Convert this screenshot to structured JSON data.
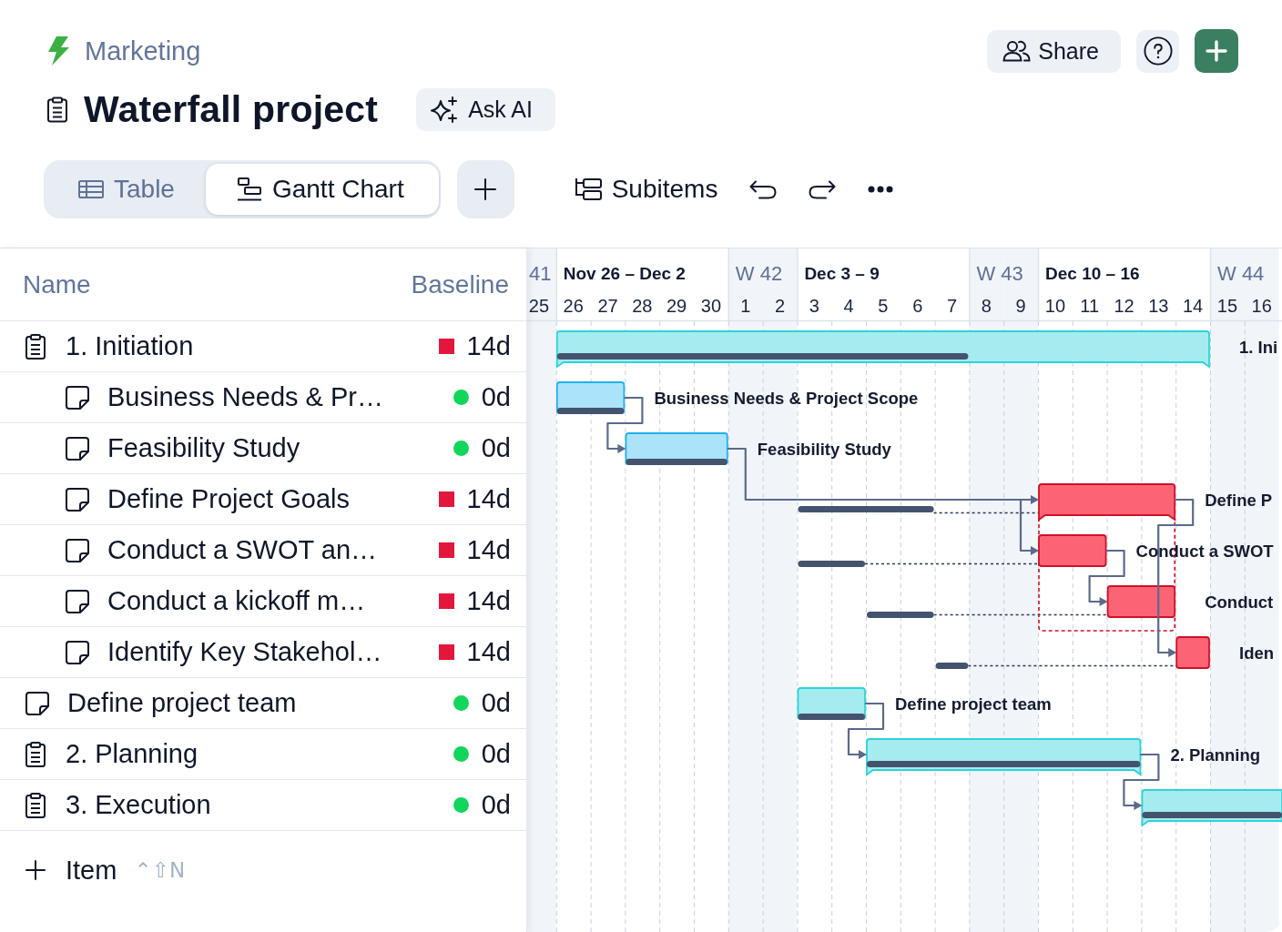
{
  "workspace": {
    "name": "Marketing"
  },
  "header": {
    "share": "Share"
  },
  "board": {
    "title": "Waterfall project",
    "ask_ai": "Ask AI"
  },
  "views": [
    {
      "kind": "table",
      "label": "Table",
      "selected": false
    },
    {
      "kind": "gantt",
      "label": "Gantt Chart",
      "selected": true
    }
  ],
  "toolbar": {
    "subitems": "Subitems"
  },
  "table": {
    "columns": [
      "Name",
      "Baseline"
    ],
    "rows": [
      {
        "kind": "group",
        "name": "1. Initiation",
        "baseline": "14d",
        "marker": {
          "kind": "square",
          "color": "#e3173d"
        },
        "children": [
          {
            "kind": "task",
            "name": "Business Needs & Pr…",
            "baseline": "0d",
            "marker": {
              "kind": "dot",
              "color": "#11d65b"
            }
          },
          {
            "kind": "task",
            "name": "Feasibility Study",
            "baseline": "0d",
            "marker": {
              "kind": "dot",
              "color": "#11d65b"
            }
          },
          {
            "kind": "task",
            "name": "Define Project Goals",
            "baseline": "14d",
            "marker": {
              "kind": "square",
              "color": "#e3173d"
            }
          },
          {
            "kind": "task",
            "name": "Conduct a SWOT an…",
            "baseline": "14d",
            "marker": {
              "kind": "square",
              "color": "#e3173d"
            }
          },
          {
            "kind": "task",
            "name": "Conduct a kickoff m…",
            "baseline": "14d",
            "marker": {
              "kind": "square",
              "color": "#e3173d"
            }
          },
          {
            "kind": "task",
            "name": "Identify Key Stakehol…",
            "baseline": "14d",
            "marker": {
              "kind": "square",
              "color": "#e3173d"
            }
          }
        ]
      },
      {
        "kind": "task",
        "name": "Define project team",
        "baseline": "0d",
        "marker": {
          "kind": "dot",
          "color": "#11d65b"
        }
      },
      {
        "kind": "group",
        "name": "2. Planning",
        "baseline": "0d",
        "marker": {
          "kind": "dot",
          "color": "#11d65b"
        }
      },
      {
        "kind": "group",
        "name": "3. Execution",
        "baseline": "0d",
        "marker": {
          "kind": "dot",
          "color": "#11d65b"
        }
      }
    ],
    "add_item": {
      "label": "Item",
      "shortcut": "⌃⇧N"
    }
  },
  "timeline": {
    "weeks": [
      {
        "label": "41"
      },
      {
        "label": "Nov 26 – Dec 2"
      },
      {
        "label": "W 42"
      },
      {
        "label": "Dec 3 – 9"
      },
      {
        "label": "W 43"
      },
      {
        "label": "Dec 10 – 16"
      },
      {
        "label": "W 44"
      }
    ],
    "days": [
      {
        "label": "25",
        "weekend": true
      },
      {
        "label": "26",
        "weekend": false
      },
      {
        "label": "27",
        "weekend": false
      },
      {
        "label": "28",
        "weekend": false
      },
      {
        "label": "29",
        "weekend": false
      },
      {
        "label": "30",
        "weekend": false
      },
      {
        "label": "1",
        "weekend": true
      },
      {
        "label": "2",
        "weekend": true
      },
      {
        "label": "3",
        "weekend": false
      },
      {
        "label": "4",
        "weekend": false
      },
      {
        "label": "5",
        "weekend": false
      },
      {
        "label": "6",
        "weekend": false
      },
      {
        "label": "7",
        "weekend": false
      },
      {
        "label": "8",
        "weekend": true
      },
      {
        "label": "9",
        "weekend": true
      },
      {
        "label": "10",
        "weekend": false
      },
      {
        "label": "11",
        "weekend": false
      },
      {
        "label": "12",
        "weekend": false
      },
      {
        "label": "13",
        "weekend": false
      },
      {
        "label": "14",
        "weekend": false
      },
      {
        "label": "15",
        "weekend": true
      },
      {
        "label": "16",
        "weekend": true
      }
    ]
  },
  "gantt": {
    "bars": [
      {
        "kind": "summary",
        "label": "1. Ini",
        "color": "#a6ecef"
      },
      {
        "kind": "task",
        "label": "Business Needs & Project Scope",
        "color": "#abe3fb"
      },
      {
        "kind": "task",
        "label": "Feasibility Study",
        "color": "#abe3fb"
      },
      {
        "kind": "summary",
        "label": "Define P",
        "color": "#fc6475"
      },
      {
        "kind": "task",
        "label": "Conduct a SWOT",
        "color": "#fc6475"
      },
      {
        "kind": "task",
        "label": "Conduct",
        "color": "#fc6475"
      },
      {
        "kind": "task",
        "label": "Iden",
        "color": "#fc6475"
      },
      {
        "kind": "task",
        "label": "Define project team",
        "color": "#a6ecef"
      },
      {
        "kind": "summary",
        "label": "2. Planning",
        "color": "#a6ecef"
      },
      {
        "kind": "summary",
        "color": "#a6ecef"
      }
    ]
  }
}
